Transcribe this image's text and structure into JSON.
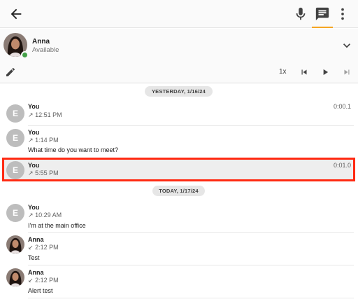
{
  "toolbar": {
    "back_icon": "arrow-left-icon",
    "mic_icon": "microphone-icon",
    "chat_icon": "message-icon",
    "more_icon": "more-vertical-icon",
    "accent": "#f5a623"
  },
  "contact": {
    "name": "Anna",
    "status": "Available",
    "status_color": "#43a047"
  },
  "playback": {
    "speed_label": "1x"
  },
  "date_dividers": [
    {
      "label": "YESTERDAY, 1/16/24"
    },
    {
      "label": "TODAY, 1/17/24"
    }
  ],
  "messages": [
    {
      "sender": "You",
      "avatar_letter": "E",
      "direction_icon": "↗",
      "time": "12:51 PM",
      "text": "",
      "duration": "0:00.1"
    },
    {
      "sender": "You",
      "avatar_letter": "E",
      "direction_icon": "↗",
      "time": "1:14 PM",
      "text": "What time do you want to meet?",
      "duration": ""
    },
    {
      "sender": "You",
      "avatar_letter": "E",
      "direction_icon": "↗",
      "time": "5:55 PM",
      "text": "",
      "duration": "0:01.0",
      "highlighted": true
    },
    {
      "sender": "You",
      "avatar_letter": "E",
      "direction_icon": "↗",
      "time": "10:29 AM",
      "text": "I'm at the main office",
      "duration": ""
    },
    {
      "sender": "Anna",
      "avatar_letter": "",
      "direction_icon": "↙",
      "time": "2:12 PM",
      "text": "Test",
      "duration": ""
    },
    {
      "sender": "Anna",
      "avatar_letter": "",
      "direction_icon": "↙",
      "time": "2:12 PM",
      "text": "Alert test",
      "duration": ""
    }
  ],
  "highlight_color": "#ff2a12"
}
